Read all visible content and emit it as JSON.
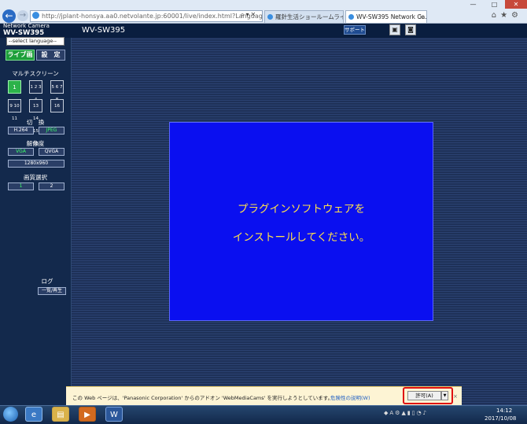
{
  "browser": {
    "url": "http://jplant-honsya.aa0.netvolante.jp:60001/live/index.html?Language=1/",
    "tabs": [
      {
        "label": "羅針生活ショールームライブ..."
      },
      {
        "label": "WV-SW395 Network Ca...",
        "close": "×"
      }
    ],
    "window_controls": {
      "minimize": "—",
      "maximize": "□",
      "close": "✕"
    }
  },
  "camera": {
    "brand_line1": "Network Camera",
    "brand_line2": "WV-SW395",
    "title": "WV-SW395",
    "support_label": "サポート"
  },
  "sidebar": {
    "language_select": "--select language--",
    "live_tab": "ライブ画",
    "setup_tab": "設　定",
    "multiscreen_label": "マルチスクリーン",
    "grid_buttons": [
      {
        "label": "1"
      },
      {
        "label": "1 2 3 4"
      },
      {
        "label": "5 6 7 8"
      },
      {
        "label": "9 10 11 12"
      },
      {
        "label": "13 14 15 16"
      },
      {
        "label": "16"
      }
    ],
    "switch_label": "切　換",
    "codec_buttons": [
      "H.264",
      "JPEG"
    ],
    "resolution_label": "解像度",
    "resolution_buttons": [
      "VGA",
      "QVGA",
      "1280x960"
    ],
    "quality_label": "画質選択",
    "quality_buttons": [
      "1",
      "2"
    ],
    "log_label": "ログ",
    "log_button": "一覧/再生"
  },
  "main": {
    "plugin_line1": "プラグインソフトウェアを",
    "plugin_line2": "インストールしてください。"
  },
  "info_bar": {
    "message": "この Web ページは、'Panasonic Corporation' からのアドオン 'WebMediaCams' を実行しようとしています。",
    "risk_link": "危険性の説明(W)",
    "allow_button": "許可(A)",
    "dropdown": "▼",
    "close": "×"
  },
  "taskbar": {
    "time": "14:12",
    "date": "2017/10/08",
    "word_icon": "W"
  },
  "colors": {
    "panel_blue": "#0a0ff0",
    "message_yellow": "#ffe14a",
    "active_green": "#1d9f3a",
    "highlight_red": "#e01010"
  }
}
